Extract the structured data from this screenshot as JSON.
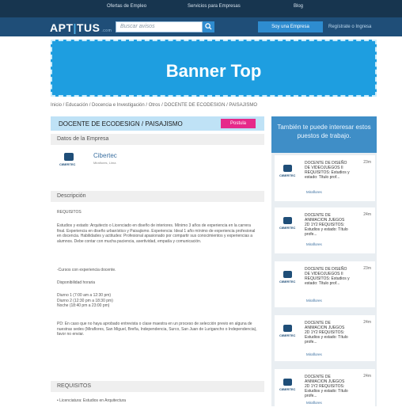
{
  "topnav": {
    "items": [
      "Ofertas de Empleo",
      "Servicios para Empresas",
      "Blog"
    ]
  },
  "header": {
    "logo_text": "APT",
    "logo_sep": "|",
    "logo_text2": "TUS",
    "logo_suffix": ".com",
    "search_placeholder": "Buscar avisos",
    "empresa_button": "Soy una Empresa",
    "login_text": "Regístrate o Ingresa"
  },
  "banner": {
    "label": "Banner Top"
  },
  "breadcrumb": "Inicio / Educación / Docencia e Investigación / Otros / DOCENTE DE ECODESIGN / PAISAJISMO",
  "job": {
    "title": "DOCENTE DE ECODESIGN / PAISAJISMO",
    "apply_label": "Postula",
    "company_section": "Datos de la Empresa",
    "company_name": "Cibertec",
    "company_sub": "Mirafiores, Lima",
    "company_logo_text": "CIBERTEC",
    "description_title": "Descripción",
    "req_label": "REQUISITOS",
    "desc_p1": "Estudios y estado: Arquitecto o Licenciado en diseño de interiores. Mínimo 3 años de experiencia en la carrera final. Experiencia en diseño urbanístico y Paisajismo. Experiencia: Ideal 1 año mínimo de experiencia profesional en docencia. Habilidades y actitudes: Profesional apasionado por compartir sus conocimientos y experiencias a alumnos. Debe contar con mucha paciencia, asertividad, empatía y comunicación.",
    "desc_p2": "-Cursos con experiencia docente.",
    "desc_p3": "Disponibilidad horaria",
    "desc_p4": "Diurno 1 (7:00 am a 12:30 pm)\nDiurno 2 (12:30 pm a 18:30 pm)\nNoche (18:40 pm a 23:00 pm)",
    "desc_p5": "PD: En caso que no haya aprobado entrevista o clase maestra en un proceso de selección previo en alguna de nuestras sedes (Miraflores, San Miguel, Breña, Independencia, Surco, San Juan de Lurigancho o Independencia), favor no enviar.",
    "requirements_title": "REQUISITOS",
    "requirements_item": "• Licenciatura: Estudios en Arquitectura"
  },
  "sidebar": {
    "heading": "También te puede interesar estos puestos de trabajo.",
    "cards": [
      {
        "title": "DOCENTE DE DISEÑO DE VIDEOJUEGOS II REQUISITOS: Estudios y estado: Título prof...",
        "age": "23m",
        "location": "Miraflores"
      },
      {
        "title": "DOCENTE DE ANIMACION JUEGOS 2D 1Y2 REQUISITOS: Estudios y estado: Título profe...",
        "age": "24m",
        "location": "Miraflores"
      },
      {
        "title": "DOCENTE DE DISEÑO DE VIDEOJUEGOS II REQUISITOS: Estudios y estado: Título prof...",
        "age": "23m",
        "location": "Miraflores"
      },
      {
        "title": "DOCENTE DE ANIMACION JUEGOS 2D 1Y2 REQUISITOS: Estudios y estado: Título profe...",
        "age": "24m",
        "location": "Miraflores"
      },
      {
        "title": "DOCENTE DE ANIMACION JUEGOS 2D 1Y2 REQUISITOS: Estudios y estado: Título profe...",
        "age": "24m",
        "location": "Miraflores"
      }
    ],
    "logo_text": "CIBERTEC"
  },
  "colors": {
    "nav_dark": "#17354f",
    "brand_bar": "#1f4e78",
    "accent_blue": "#2e8cd0",
    "banner_blue": "#1e9ee0",
    "apply_pink": "#e6298a",
    "job_head": "#bfe2f6",
    "sidebar_head": "#3f8ec7"
  }
}
